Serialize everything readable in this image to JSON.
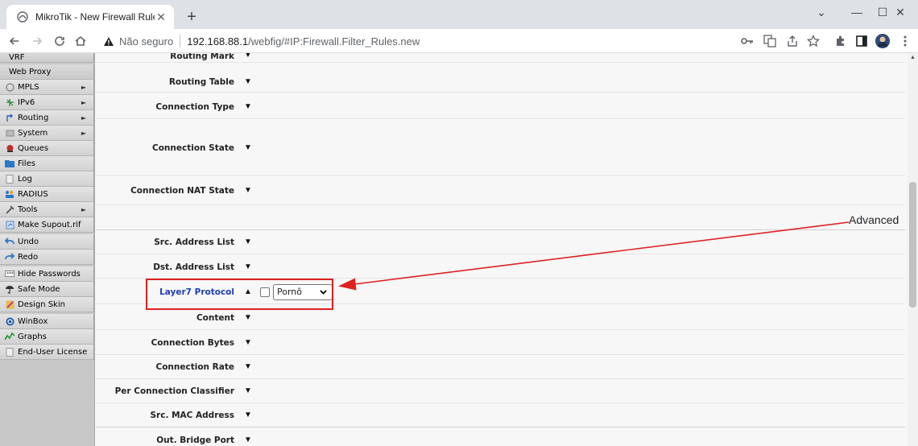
{
  "browser": {
    "tab_title": "MikroTik - New Firewall Rule at a",
    "tab_close": "✕",
    "new_tab": "+",
    "window_controls": {
      "dropdown": "⌄",
      "minimize": "—",
      "maximize": "☐",
      "close": "✕"
    },
    "address": {
      "not_secure": "Não seguro",
      "host": "192.168.88.1",
      "path": "/webfig/#IP:Firewall.Filter_Rules.new"
    }
  },
  "sidebar": {
    "items": [
      {
        "label": "VRF"
      },
      {
        "label": "Web Proxy"
      },
      {
        "label": "MPLS",
        "icon": "mpls-icon",
        "has_submenu": true
      },
      {
        "label": "IPv6",
        "icon": "ipv6-icon",
        "has_submenu": true
      },
      {
        "label": "Routing",
        "icon": "routing-icon",
        "has_submenu": true
      },
      {
        "label": "System",
        "icon": "system-icon",
        "has_submenu": true
      },
      {
        "label": "Queues",
        "icon": "queues-icon"
      },
      {
        "label": "Files",
        "icon": "folder-icon"
      },
      {
        "label": "Log",
        "icon": "log-icon"
      },
      {
        "label": "RADIUS",
        "icon": "radius-icon"
      },
      {
        "label": "Tools",
        "icon": "tools-icon",
        "has_submenu": true
      },
      {
        "label": "Make Supout.rif",
        "icon": "supout-icon"
      },
      {
        "label": "Undo",
        "icon": "undo-icon"
      },
      {
        "label": "Redo",
        "icon": "redo-icon"
      },
      {
        "label": "Hide Passwords",
        "icon": "password-icon"
      },
      {
        "label": "Safe Mode",
        "icon": "safe-mode-icon"
      },
      {
        "label": "Design Skin",
        "icon": "design-skin-icon"
      },
      {
        "label": "WinBox",
        "icon": "winbox-icon"
      },
      {
        "label": "Graphs",
        "icon": "graphs-icon"
      },
      {
        "label": "End-User License",
        "icon": "license-icon"
      }
    ],
    "submenu_arrow": "►"
  },
  "form": {
    "fields": [
      {
        "label": "Routing Mark",
        "toggle": "▼"
      },
      {
        "label": "Routing Table",
        "toggle": "▼"
      },
      {
        "label": "Connection Type",
        "toggle": "▼"
      },
      {
        "label": "Connection State",
        "toggle": "▼"
      },
      {
        "label": "Connection NAT State",
        "toggle": "▼"
      },
      {
        "label": "Src. Address List",
        "toggle": "▼"
      },
      {
        "label": "Dst. Address List",
        "toggle": "▼"
      },
      {
        "label": "Layer7 Protocol",
        "toggle": "▲",
        "value": "Pornô",
        "checked": false
      },
      {
        "label": "Content",
        "toggle": "▼"
      },
      {
        "label": "Connection Bytes",
        "toggle": "▼"
      },
      {
        "label": "Connection Rate",
        "toggle": "▼"
      },
      {
        "label": "Per Connection Classifier",
        "toggle": "▼"
      },
      {
        "label": "Src. MAC Address",
        "toggle": "▼"
      },
      {
        "label": "Out. Bridge Port",
        "toggle": "▼"
      }
    ],
    "select_caret": "⌄"
  },
  "annotation": {
    "text": "Advanced",
    "color": "#e02020"
  }
}
